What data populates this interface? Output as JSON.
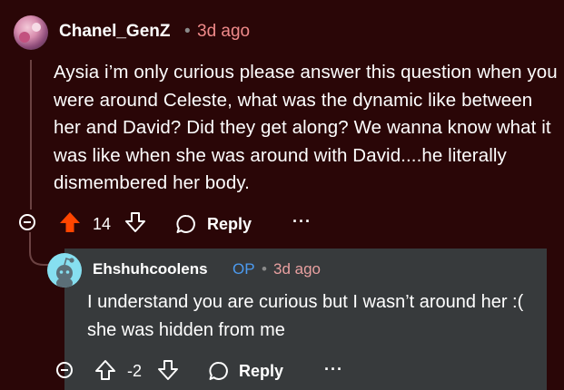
{
  "comment": {
    "username": "Chanel_GenZ",
    "separator": "•",
    "time": "3d ago",
    "body": "Aysia i’m only curious please answer this question when you were around Celeste, what was the dynamic like between her and David? Did they get along? We wanna know what it was like when she was around with David....he literally dismembered her body.",
    "score": "14",
    "reply_label": "Reply",
    "more_label": "···",
    "upvote_icon": "upvote-filled-icon",
    "upvote_color": "#ff4500"
  },
  "reply": {
    "username": "Ehshuhcoolens",
    "op_badge": "OP",
    "separator": "•",
    "time": "3d ago",
    "body": "I understand you are curious but I wasn’t around her :( she was hidden from me",
    "score": "-2",
    "reply_label": "Reply",
    "more_label": "···",
    "op_color": "#4c9bf0"
  },
  "colors": {
    "background": "#2a0607",
    "card": "#373a3c"
  }
}
